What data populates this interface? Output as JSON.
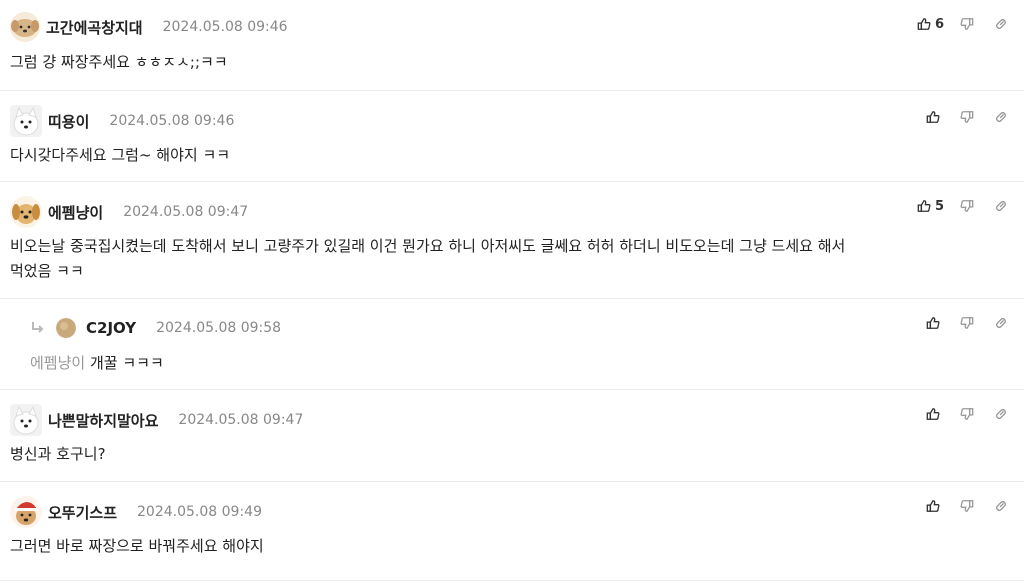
{
  "comments": [
    {
      "nick": "고간에곡창지대",
      "date": "2024.05.08 09:46",
      "text": "그럼 걍 짜장주세요 ㅎㅎㅈㅅ;;ㅋㅋ",
      "likes": "6",
      "avatar": "puppy-icon"
    },
    {
      "nick": "띠용이",
      "date": "2024.05.08 09:46",
      "text": "다시갖다주세요 그럼~ 해야지 ㅋㅋ",
      "likes": "",
      "avatar": "samoyed-icon"
    },
    {
      "nick": "에펨냥이",
      "date": "2024.05.08 09:47",
      "text": "비오는날 중국집시켰는데 도착해서 보니 고량주가 있길래 이건 뭔가요 하니 아저씨도 글쎄요 허허 하더니 비도오는데 그냥 드세요 해서",
      "text2": "먹었음 ㅋㅋ",
      "likes": "5",
      "avatar": "golden-puppy-icon"
    },
    {
      "nick": "C2JOY",
      "date": "2024.05.08 09:58",
      "mention": "에펨냥이",
      "text": "개꿀 ㅋㅋㅋ",
      "likes": "",
      "avatar": "circle-avatar-icon"
    },
    {
      "nick": "나쁜말하지말아요",
      "date": "2024.05.08 09:47",
      "text": "병신과 호구니?",
      "likes": "",
      "avatar": "samoyed-icon"
    },
    {
      "nick": "오뚜기스프",
      "date": "2024.05.08 09:49",
      "text": "그러면 바로 짜장으로 바꿔주세요 해야지",
      "likes": "",
      "avatar": "santa-puppy-icon"
    }
  ],
  "colors": {
    "divider": "#ececec",
    "date": "#888888",
    "mention": "#999999",
    "icon": "#888888"
  }
}
